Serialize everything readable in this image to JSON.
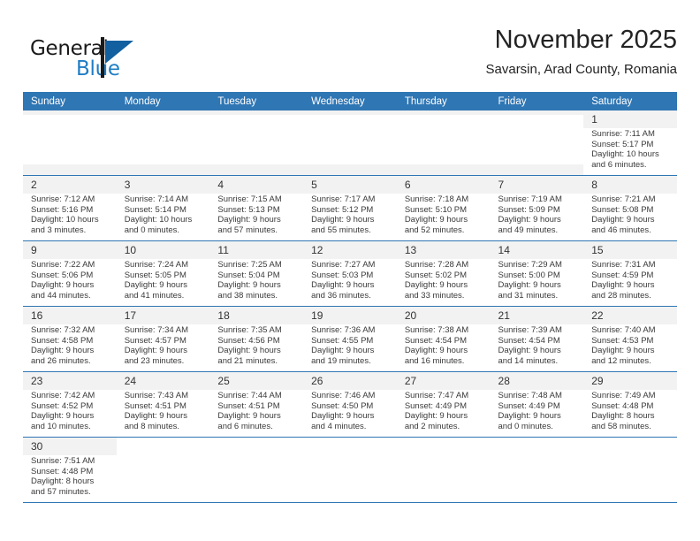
{
  "brand": {
    "name_part1": "General",
    "name_part2": "Blue",
    "flag_icon": "blue-triangle-flag-icon",
    "accent_color": "#1f7dc4"
  },
  "header": {
    "title": "November 2025",
    "subtitle": "Savarsin, Arad County, Romania"
  },
  "calendar": {
    "header_bg": "#2f76b4",
    "weekdays": [
      "Sunday",
      "Monday",
      "Tuesday",
      "Wednesday",
      "Thursday",
      "Friday",
      "Saturday"
    ],
    "weeks": [
      [
        {
          "day": "",
          "lines": []
        },
        {
          "day": "",
          "lines": []
        },
        {
          "day": "",
          "lines": []
        },
        {
          "day": "",
          "lines": []
        },
        {
          "day": "",
          "lines": []
        },
        {
          "day": "",
          "lines": []
        },
        {
          "day": "1",
          "lines": [
            "Sunrise: 7:11 AM",
            "Sunset: 5:17 PM",
            "Daylight: 10 hours",
            "and 6 minutes."
          ]
        }
      ],
      [
        {
          "day": "2",
          "lines": [
            "Sunrise: 7:12 AM",
            "Sunset: 5:16 PM",
            "Daylight: 10 hours",
            "and 3 minutes."
          ]
        },
        {
          "day": "3",
          "lines": [
            "Sunrise: 7:14 AM",
            "Sunset: 5:14 PM",
            "Daylight: 10 hours",
            "and 0 minutes."
          ]
        },
        {
          "day": "4",
          "lines": [
            "Sunrise: 7:15 AM",
            "Sunset: 5:13 PM",
            "Daylight: 9 hours",
            "and 57 minutes."
          ]
        },
        {
          "day": "5",
          "lines": [
            "Sunrise: 7:17 AM",
            "Sunset: 5:12 PM",
            "Daylight: 9 hours",
            "and 55 minutes."
          ]
        },
        {
          "day": "6",
          "lines": [
            "Sunrise: 7:18 AM",
            "Sunset: 5:10 PM",
            "Daylight: 9 hours",
            "and 52 minutes."
          ]
        },
        {
          "day": "7",
          "lines": [
            "Sunrise: 7:19 AM",
            "Sunset: 5:09 PM",
            "Daylight: 9 hours",
            "and 49 minutes."
          ]
        },
        {
          "day": "8",
          "lines": [
            "Sunrise: 7:21 AM",
            "Sunset: 5:08 PM",
            "Daylight: 9 hours",
            "and 46 minutes."
          ]
        }
      ],
      [
        {
          "day": "9",
          "lines": [
            "Sunrise: 7:22 AM",
            "Sunset: 5:06 PM",
            "Daylight: 9 hours",
            "and 44 minutes."
          ]
        },
        {
          "day": "10",
          "lines": [
            "Sunrise: 7:24 AM",
            "Sunset: 5:05 PM",
            "Daylight: 9 hours",
            "and 41 minutes."
          ]
        },
        {
          "day": "11",
          "lines": [
            "Sunrise: 7:25 AM",
            "Sunset: 5:04 PM",
            "Daylight: 9 hours",
            "and 38 minutes."
          ]
        },
        {
          "day": "12",
          "lines": [
            "Sunrise: 7:27 AM",
            "Sunset: 5:03 PM",
            "Daylight: 9 hours",
            "and 36 minutes."
          ]
        },
        {
          "day": "13",
          "lines": [
            "Sunrise: 7:28 AM",
            "Sunset: 5:02 PM",
            "Daylight: 9 hours",
            "and 33 minutes."
          ]
        },
        {
          "day": "14",
          "lines": [
            "Sunrise: 7:29 AM",
            "Sunset: 5:00 PM",
            "Daylight: 9 hours",
            "and 31 minutes."
          ]
        },
        {
          "day": "15",
          "lines": [
            "Sunrise: 7:31 AM",
            "Sunset: 4:59 PM",
            "Daylight: 9 hours",
            "and 28 minutes."
          ]
        }
      ],
      [
        {
          "day": "16",
          "lines": [
            "Sunrise: 7:32 AM",
            "Sunset: 4:58 PM",
            "Daylight: 9 hours",
            "and 26 minutes."
          ]
        },
        {
          "day": "17",
          "lines": [
            "Sunrise: 7:34 AM",
            "Sunset: 4:57 PM",
            "Daylight: 9 hours",
            "and 23 minutes."
          ]
        },
        {
          "day": "18",
          "lines": [
            "Sunrise: 7:35 AM",
            "Sunset: 4:56 PM",
            "Daylight: 9 hours",
            "and 21 minutes."
          ]
        },
        {
          "day": "19",
          "lines": [
            "Sunrise: 7:36 AM",
            "Sunset: 4:55 PM",
            "Daylight: 9 hours",
            "and 19 minutes."
          ]
        },
        {
          "day": "20",
          "lines": [
            "Sunrise: 7:38 AM",
            "Sunset: 4:54 PM",
            "Daylight: 9 hours",
            "and 16 minutes."
          ]
        },
        {
          "day": "21",
          "lines": [
            "Sunrise: 7:39 AM",
            "Sunset: 4:54 PM",
            "Daylight: 9 hours",
            "and 14 minutes."
          ]
        },
        {
          "day": "22",
          "lines": [
            "Sunrise: 7:40 AM",
            "Sunset: 4:53 PM",
            "Daylight: 9 hours",
            "and 12 minutes."
          ]
        }
      ],
      [
        {
          "day": "23",
          "lines": [
            "Sunrise: 7:42 AM",
            "Sunset: 4:52 PM",
            "Daylight: 9 hours",
            "and 10 minutes."
          ]
        },
        {
          "day": "24",
          "lines": [
            "Sunrise: 7:43 AM",
            "Sunset: 4:51 PM",
            "Daylight: 9 hours",
            "and 8 minutes."
          ]
        },
        {
          "day": "25",
          "lines": [
            "Sunrise: 7:44 AM",
            "Sunset: 4:51 PM",
            "Daylight: 9 hours",
            "and 6 minutes."
          ]
        },
        {
          "day": "26",
          "lines": [
            "Sunrise: 7:46 AM",
            "Sunset: 4:50 PM",
            "Daylight: 9 hours",
            "and 4 minutes."
          ]
        },
        {
          "day": "27",
          "lines": [
            "Sunrise: 7:47 AM",
            "Sunset: 4:49 PM",
            "Daylight: 9 hours",
            "and 2 minutes."
          ]
        },
        {
          "day": "28",
          "lines": [
            "Sunrise: 7:48 AM",
            "Sunset: 4:49 PM",
            "Daylight: 9 hours",
            "and 0 minutes."
          ]
        },
        {
          "day": "29",
          "lines": [
            "Sunrise: 7:49 AM",
            "Sunset: 4:48 PM",
            "Daylight: 8 hours",
            "and 58 minutes."
          ]
        }
      ],
      [
        {
          "day": "30",
          "lines": [
            "Sunrise: 7:51 AM",
            "Sunset: 4:48 PM",
            "Daylight: 8 hours",
            "and 57 minutes."
          ]
        },
        {
          "day": "",
          "lines": []
        },
        {
          "day": "",
          "lines": []
        },
        {
          "day": "",
          "lines": []
        },
        {
          "day": "",
          "lines": []
        },
        {
          "day": "",
          "lines": []
        },
        {
          "day": "",
          "lines": []
        }
      ]
    ]
  }
}
